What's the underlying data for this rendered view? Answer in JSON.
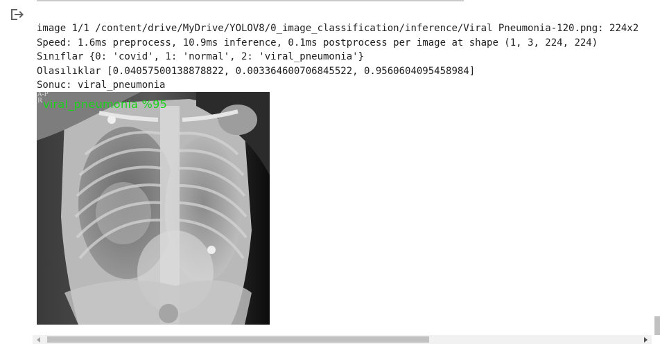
{
  "cell": {
    "output_icon": "exit-to-app-icon"
  },
  "output": {
    "lines": [
      "image 1/1 /content/drive/MyDrive/YOLOV8/0_image_classification/inference/Viral Pneumonia-120.png: 224x2",
      "Speed: 1.6ms preprocess, 10.9ms inference, 0.1ms postprocess per image at shape (1, 3, 224, 224)",
      "Sınıflar {0: 'covid', 1: 'normal', 2: 'viral_pneumonia'}",
      "Olasılıklar [0.04057500138878822, 0.003364600706845522, 0.9560604095458984]",
      "Sonuc: viral_pneumonia"
    ]
  },
  "image": {
    "prediction_label": "viral_pneumonia %95",
    "corner_marker": "A-P\nR",
    "label_color": "#19d419"
  },
  "scrollbar": {
    "horizontal_position": 0.0
  }
}
